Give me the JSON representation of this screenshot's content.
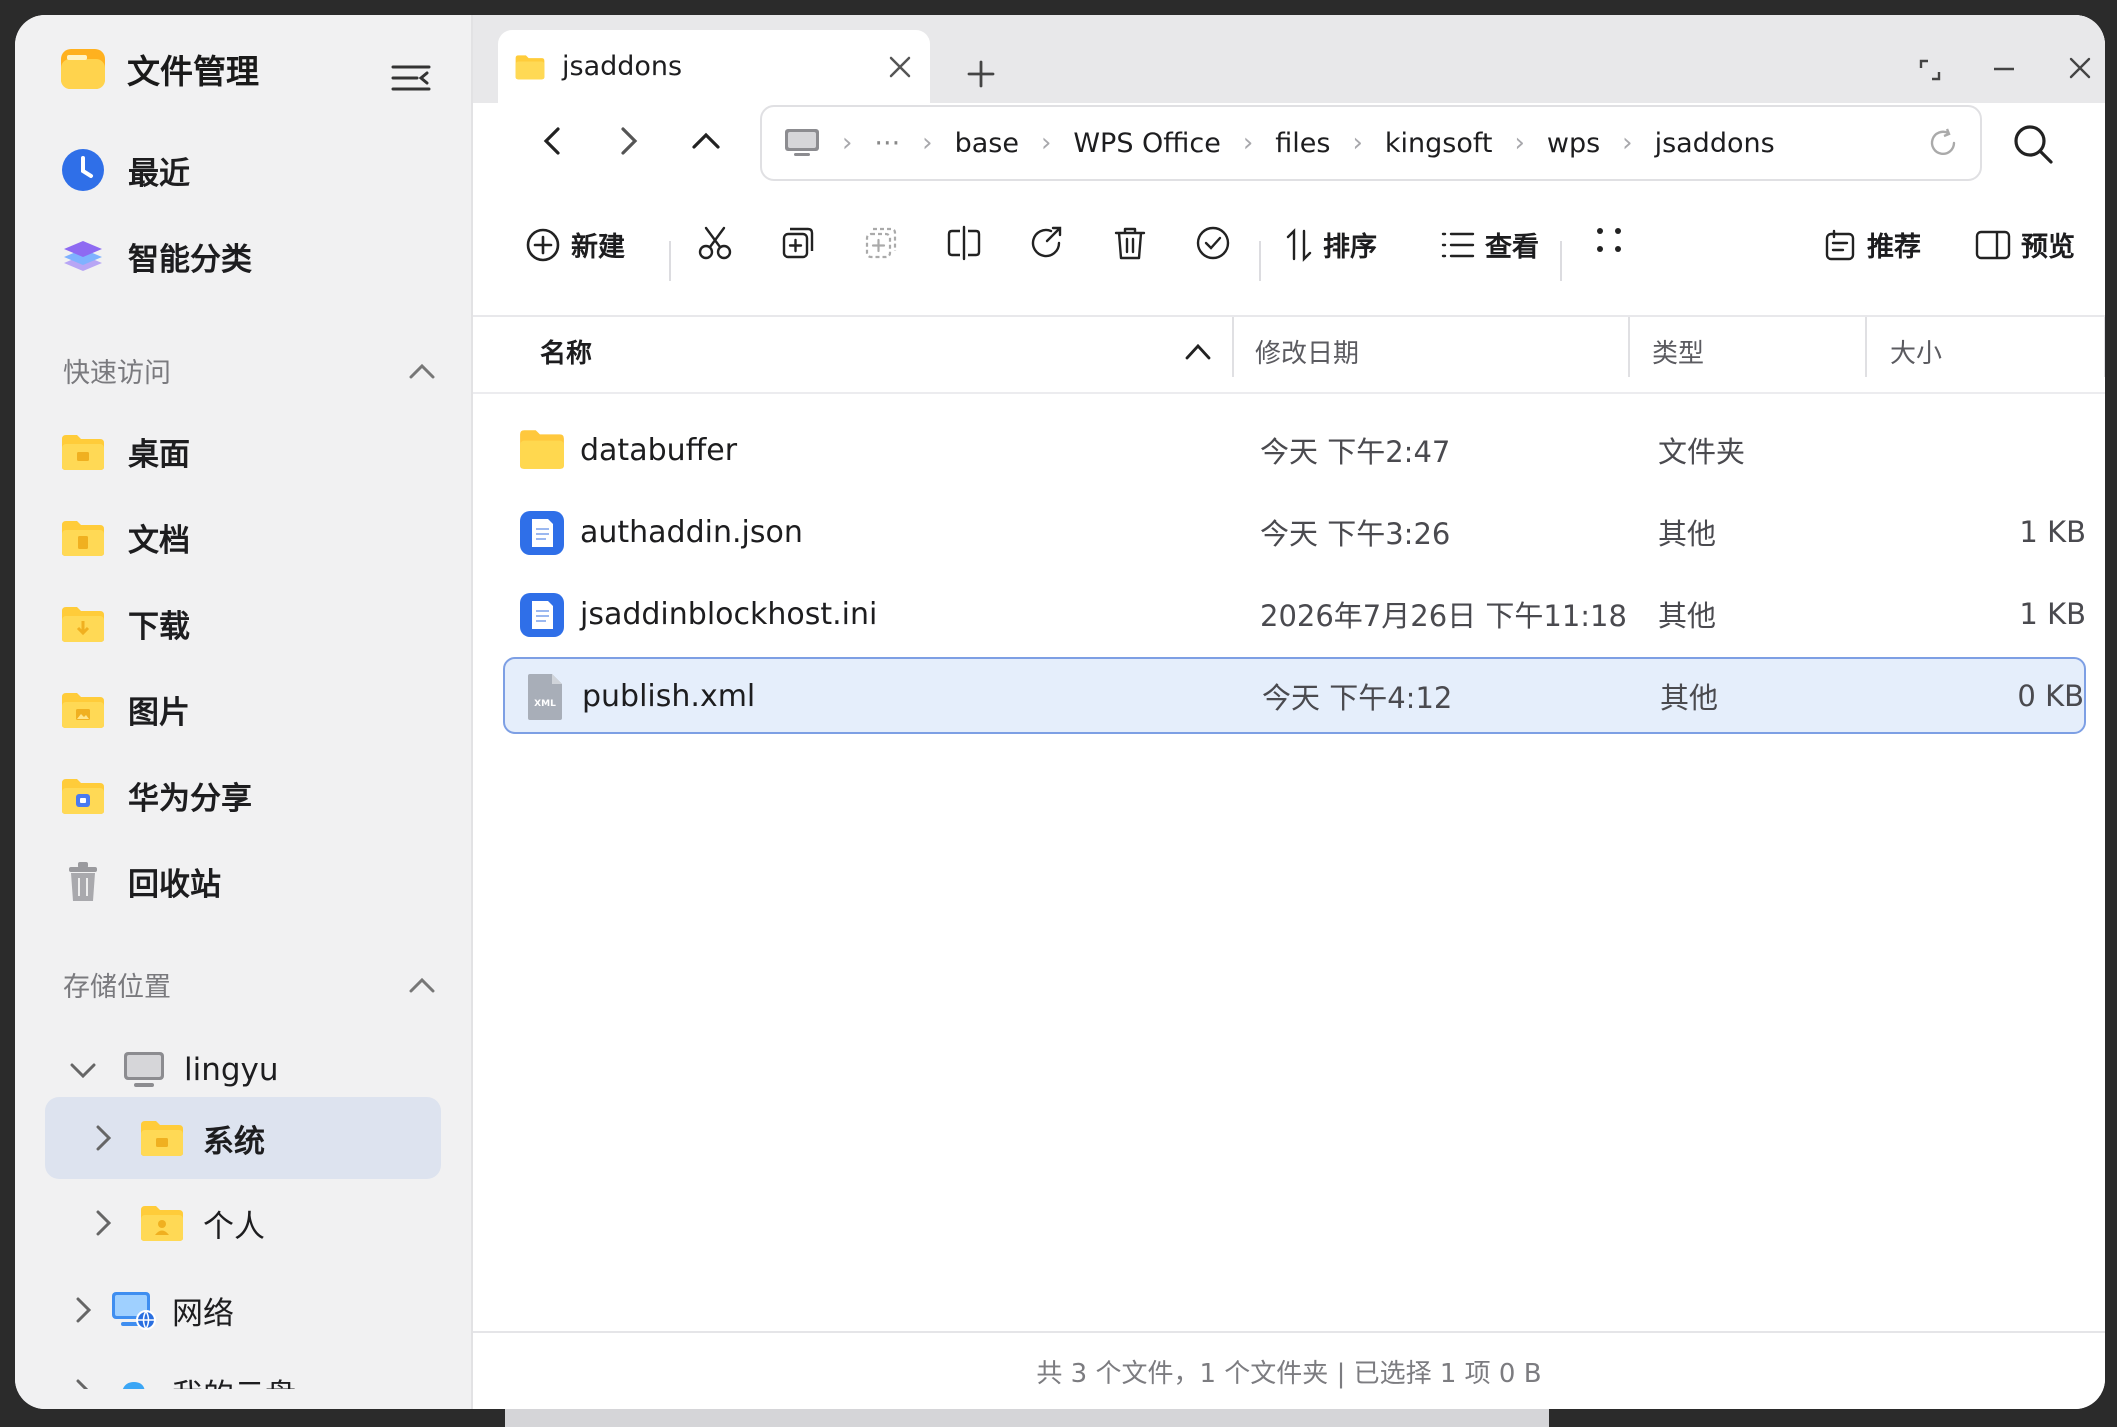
{
  "app": {
    "title": "文件管理"
  },
  "sidebar": {
    "items": [
      {
        "label": "最近",
        "icon": "clock-icon"
      },
      {
        "label": "智能分类",
        "icon": "layers-icon"
      }
    ],
    "quick_access": {
      "title": "快速访问",
      "items": [
        {
          "label": "桌面",
          "icon": "desktop-folder-icon"
        },
        {
          "label": "文档",
          "icon": "documents-folder-icon"
        },
        {
          "label": "下载",
          "icon": "download-folder-icon"
        },
        {
          "label": "图片",
          "icon": "pictures-folder-icon"
        },
        {
          "label": "华为分享",
          "icon": "huawei-share-folder-icon"
        },
        {
          "label": "回收站",
          "icon": "trash-icon"
        }
      ]
    },
    "storage": {
      "title": "存储位置",
      "device": "lingyu",
      "children": [
        {
          "label": "系统",
          "selected": true
        },
        {
          "label": "个人"
        }
      ],
      "network": "网络",
      "cloud": "我的云盘"
    }
  },
  "tabs": [
    {
      "label": "jsaddons",
      "active": true
    }
  ],
  "breadcrumb": [
    "···",
    "base",
    "WPS Office",
    "files",
    "kingsoft",
    "wps",
    "jsaddons"
  ],
  "toolbar": {
    "new_label": "新建",
    "sort_label": "排序",
    "view_label": "查看",
    "recommend_label": "推荐",
    "preview_label": "预览"
  },
  "columns": {
    "name": "名称",
    "date": "修改日期",
    "type": "类型",
    "size": "大小"
  },
  "files": [
    {
      "name": "databuffer",
      "date": "今天 下午2:47",
      "type": "文件夹",
      "size": "",
      "icon": "folder-icon"
    },
    {
      "name": "authaddin.json",
      "date": "今天 下午3:26",
      "type": "其他",
      "size": "1 KB",
      "icon": "document-icon"
    },
    {
      "name": "jsaddinblockhost.ini",
      "date": "2026年7月26日 下午11:18",
      "type": "其他",
      "size": "1 KB",
      "icon": "document-icon"
    },
    {
      "name": "publish.xml",
      "date": "今天 下午4:12",
      "type": "其他",
      "size": "0 KB",
      "icon": "xml-file-icon",
      "selected": true,
      "icon_text": "XML"
    }
  ],
  "status": "共 3 个文件，1 个文件夹 | 已选择 1 项  0 B",
  "colors": {
    "accent": "#3478f6",
    "folder": "#ffc83d",
    "selection": "#e5eefb",
    "selection_border": "#7d9fe4"
  }
}
